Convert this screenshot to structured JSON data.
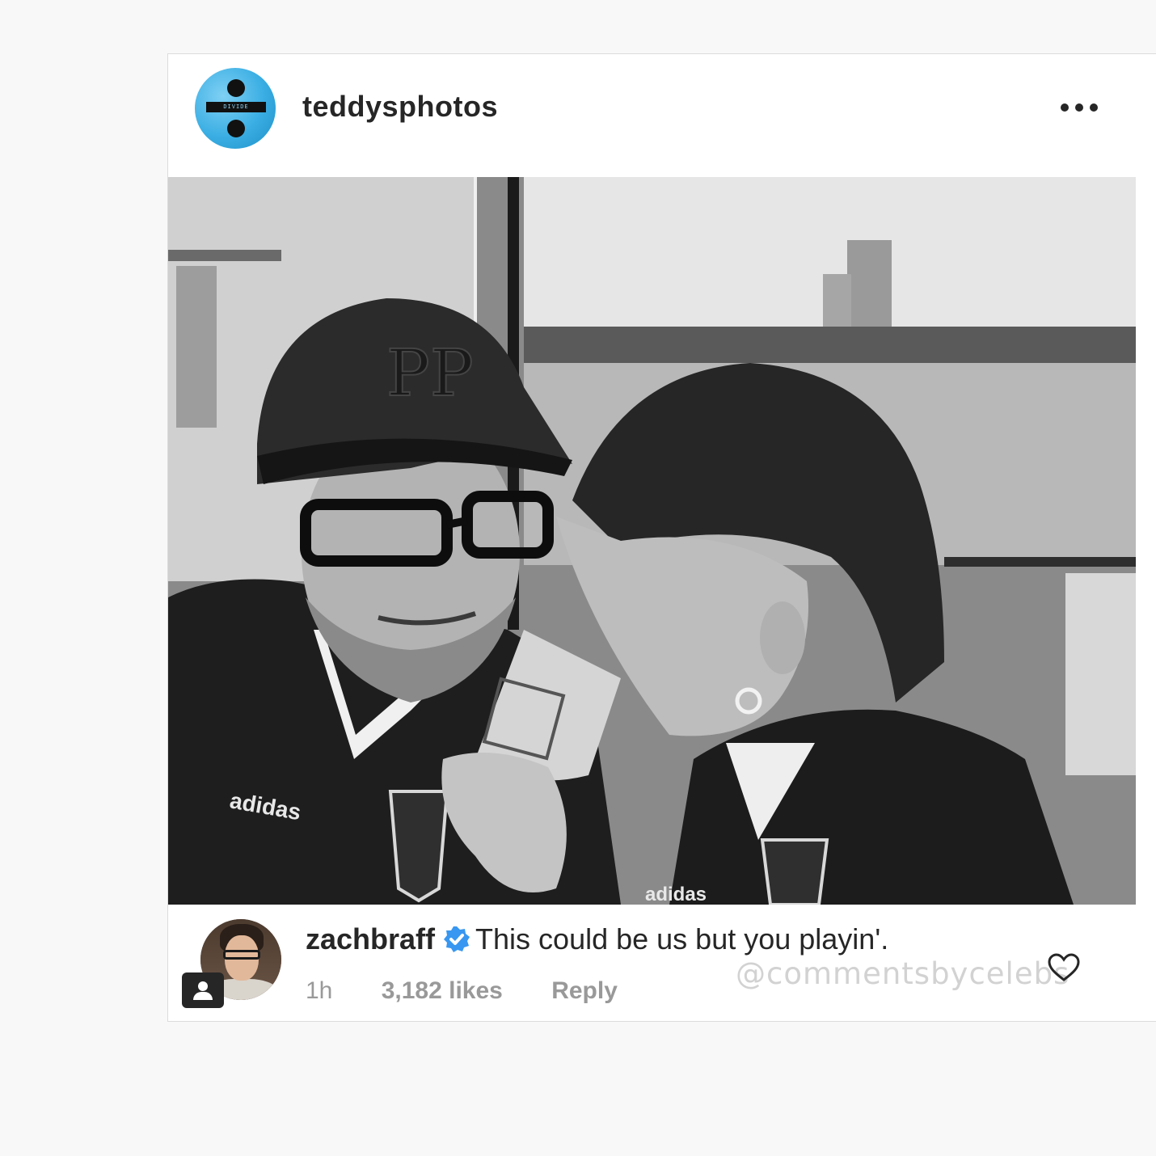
{
  "post": {
    "username": "teddysphotos",
    "avatar_text": "DIVIDE"
  },
  "comment": {
    "username": "zachbraff",
    "text": "This could be us but you playin'.",
    "time": "1h",
    "likes": "3,182 likes",
    "reply_label": "Reply"
  },
  "watermark": "@commentsbycelebs",
  "colors": {
    "verified_blue": "#3897f0",
    "text_dark": "#262626",
    "text_muted": "#999999",
    "avatar_blue": "#3aaee3"
  },
  "icons": {
    "more": "more-options-icon",
    "verified": "verified-badge-icon",
    "like": "heart-outline-icon",
    "profile": "person-icon"
  }
}
